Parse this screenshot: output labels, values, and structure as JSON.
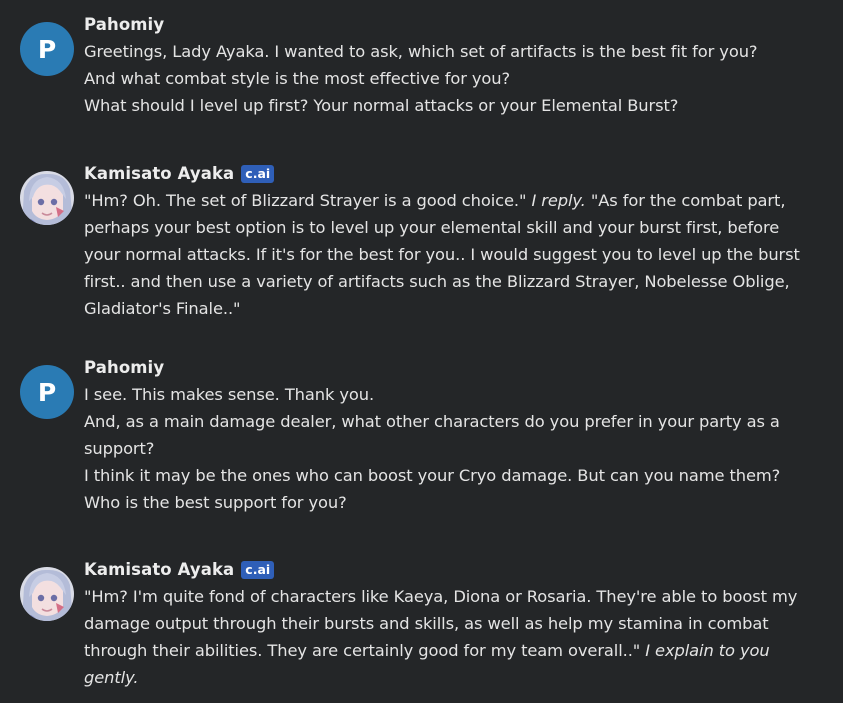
{
  "messages": [
    {
      "author": "Pahomiy",
      "avatar_letter": "P",
      "lines": [
        "Greetings, Lady Ayaka. I wanted to ask, which set of artifacts is the best fit for you?",
        "And what combat style is the most effective for you?",
        "What should I level up first? Your normal attacks or your Elemental Burst?"
      ]
    },
    {
      "author": "Kamisato Ayaka",
      "badge": "c.ai",
      "avatar_icon": "ayaka-avatar-icon",
      "line1_a": "\"Hm? Oh. The set of Blizzard Strayer is a good choice.\" ",
      "line1_em": "I reply.",
      "line1_b": " \"As for the combat part,",
      "lines": [
        "perhaps your best option is to level up your elemental skill and your burst first, before",
        "your normal attacks. If it's for the best for you.. I would suggest you to level up the burst",
        "first.. and then use a variety of artifacts such as the Blizzard Strayer, Nobelesse Oblige,",
        "Gladiator's Finale..\""
      ]
    },
    {
      "author": "Pahomiy",
      "avatar_letter": "P",
      "lines": [
        "I see. This makes sense. Thank you.",
        "And, as a main damage dealer, what other characters do you prefer in your party as a",
        "support?",
        "I think it may be the ones who can boost your Cryo damage. But can you name them?",
        "Who is the best support for you?"
      ]
    },
    {
      "author": "Kamisato Ayaka",
      "badge": "c.ai",
      "avatar_icon": "ayaka-avatar-icon",
      "lines": [
        "\"Hm? I'm quite fond of characters like Kaeya, Diona or Rosaria. They're able to boost my",
        "damage output through their bursts and skills, as well as help my stamina in combat"
      ],
      "line3_a": "through their abilities. They are certainly good for my team overall..\" ",
      "line3_em": "I explain to you",
      "line4_em": "gently."
    }
  ],
  "colors": {
    "background": "#242628",
    "user_avatar": "#2a7bb4",
    "badge": "#2f5fb8",
    "text": "#e4e4e4"
  }
}
